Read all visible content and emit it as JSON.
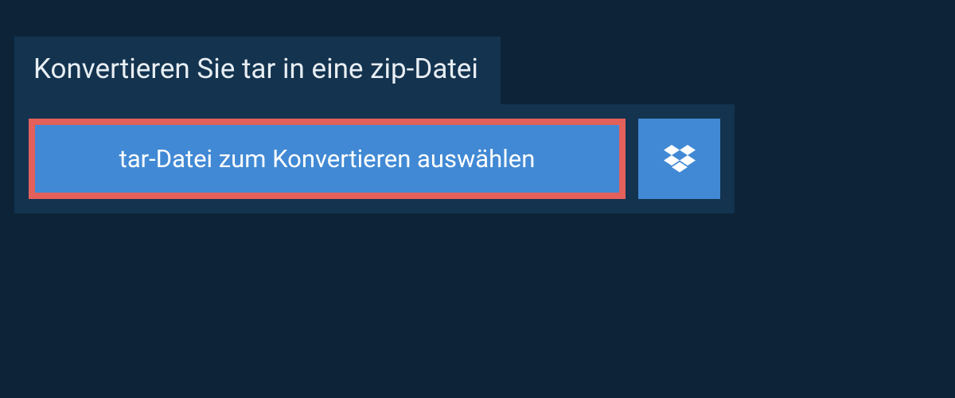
{
  "header": {
    "title": "Konvertieren Sie tar in eine zip-Datei"
  },
  "actions": {
    "select_file_label": "tar-Datei zum Konvertieren auswählen"
  },
  "colors": {
    "background": "#0d2438",
    "panel": "#13334f",
    "button_bg": "#4189d4",
    "button_border": "#e4605a"
  }
}
